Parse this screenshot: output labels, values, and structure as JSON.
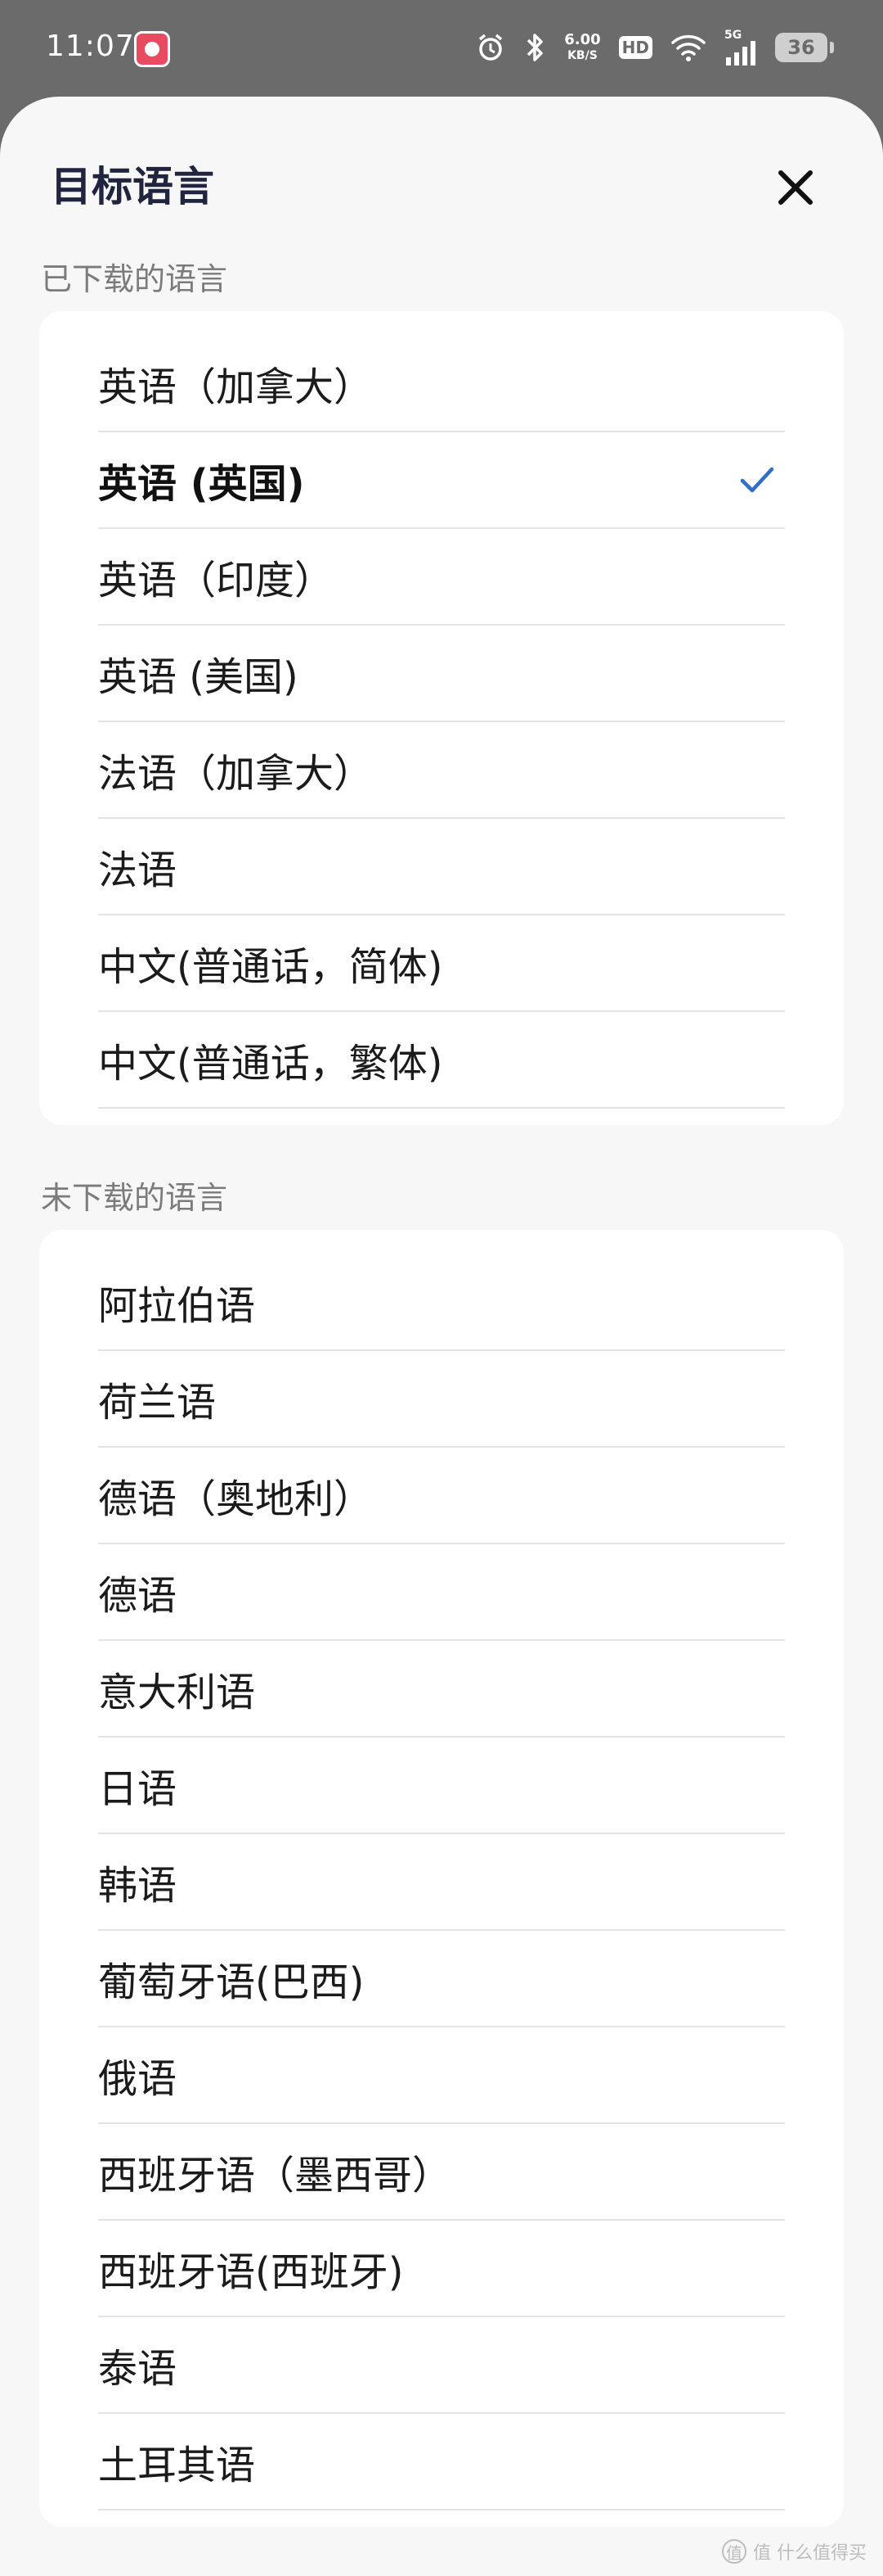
{
  "status_bar": {
    "time": "11:07",
    "net_speed_value": "6.00",
    "net_speed_unit": "KB/S",
    "hd_label": "HD",
    "signal_label": "5G",
    "battery": "36"
  },
  "sheet": {
    "title": "目标语言",
    "downloaded_label": "已下载的语言",
    "not_downloaded_label": "未下载的语言",
    "downloaded": [
      {
        "label": "英语（加拿大）",
        "selected": false
      },
      {
        "label": "英语 (英国)",
        "selected": true
      },
      {
        "label": "英语（印度）",
        "selected": false
      },
      {
        "label": "英语 (美国)",
        "selected": false
      },
      {
        "label": "法语（加拿大）",
        "selected": false
      },
      {
        "label": "法语",
        "selected": false
      },
      {
        "label": "中文(普通话，简体)",
        "selected": false
      },
      {
        "label": "中文(普通话，繁体)",
        "selected": false
      }
    ],
    "not_downloaded": [
      {
        "label": "阿拉伯语"
      },
      {
        "label": "荷兰语"
      },
      {
        "label": "德语（奥地利）"
      },
      {
        "label": "德语"
      },
      {
        "label": "意大利语"
      },
      {
        "label": "日语"
      },
      {
        "label": "韩语"
      },
      {
        "label": "葡萄牙语(巴西)"
      },
      {
        "label": "俄语"
      },
      {
        "label": "西班牙语（墨西哥）"
      },
      {
        "label": "西班牙语(西班牙)"
      },
      {
        "label": "泰语"
      },
      {
        "label": "土耳其语"
      }
    ]
  },
  "watermark": "值 什么值得买",
  "colors": {
    "accent": "#2f6fc9",
    "sheet_bg": "#f7f7f7",
    "title": "#20243f"
  }
}
